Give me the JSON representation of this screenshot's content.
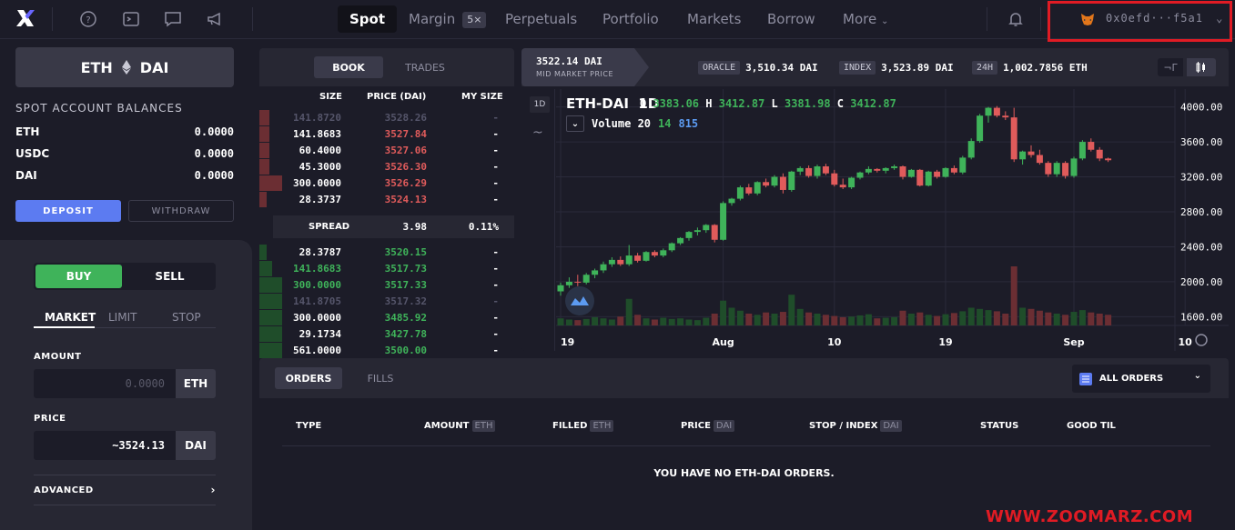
{
  "nav": {
    "tabs": [
      {
        "label": "Spot"
      },
      {
        "label": "Margin",
        "badge": "5×"
      },
      {
        "label": "Perpetuals"
      },
      {
        "label": "Portfolio"
      },
      {
        "label": "Markets"
      },
      {
        "label": "Borrow"
      },
      {
        "label": "More"
      }
    ],
    "wallet": "0x0efd···f5a1"
  },
  "market": {
    "base": "ETH",
    "quote": "DAI"
  },
  "balances": {
    "title": "SPOT ACCOUNT BALANCES",
    "rows": [
      {
        "asset": "ETH",
        "amount": "0.0000"
      },
      {
        "asset": "USDC",
        "amount": "0.0000"
      },
      {
        "asset": "DAI",
        "amount": "0.0000"
      }
    ],
    "deposit": "DEPOSIT",
    "withdraw": "WITHDRAW"
  },
  "order_form": {
    "buy": "BUY",
    "sell": "SELL",
    "types": [
      "MARKET",
      "LIMIT",
      "STOP"
    ],
    "amount_label": "AMOUNT",
    "amount_placeholder": "0.0000",
    "amount_unit": "ETH",
    "price_label": "PRICE",
    "price_value": "~3524.13",
    "price_unit": "DAI",
    "advanced": "ADVANCED"
  },
  "orderbook": {
    "tabs": [
      "BOOK",
      "TRADES"
    ],
    "headers": [
      "SIZE",
      "PRICE (DAI)",
      "MY SIZE"
    ],
    "asks": [
      {
        "size": "141.8720",
        "price": "3528.26",
        "my": "-",
        "depth": 0.04,
        "faded": true
      },
      {
        "size": "141.8683",
        "price": "3527.84",
        "my": "-",
        "depth": 0.04
      },
      {
        "size": "60.4000",
        "price": "3527.06",
        "my": "-",
        "depth": 0.04
      },
      {
        "size": "45.3000",
        "price": "3526.30",
        "my": "-",
        "depth": 0.04
      },
      {
        "size": "300.0000",
        "price": "3526.29",
        "my": "-",
        "depth": 0.09
      },
      {
        "size": "28.3737",
        "price": "3524.13",
        "my": "-",
        "depth": 0.03
      }
    ],
    "spread": {
      "label": "SPREAD",
      "value": "3.98",
      "pct": "0.11%"
    },
    "bids": [
      {
        "size": "28.3787",
        "price": "3520.15",
        "my": "-",
        "depth": 0.03
      },
      {
        "size": "141.8683",
        "price": "3517.73",
        "my": "-",
        "depth": 0.05
      },
      {
        "size": "300.0000",
        "price": "3517.33",
        "my": "-",
        "depth": 0.09
      },
      {
        "size": "141.8705",
        "price": "3517.32",
        "my": "-",
        "depth": 0.09,
        "faded": true
      },
      {
        "size": "300.0000",
        "price": "3485.92",
        "my": "-",
        "depth": 0.09
      },
      {
        "size": "29.1734",
        "price": "3427.78",
        "my": "-",
        "depth": 0.09
      },
      {
        "size": "561.0000",
        "price": "3500.00",
        "my": "-",
        "depth": 0.09
      }
    ]
  },
  "chart_header": {
    "mid_price": "3522.14 DAI",
    "mid_label": "MID MARKET PRICE",
    "oracle_tag": "ORACLE",
    "oracle_value": "3,510.34 DAI",
    "index_tag": "INDEX",
    "index_value": "3,523.89 DAI",
    "vol_tag": "24H",
    "vol_value": "1,002.7856 ETH"
  },
  "chart": {
    "interval_btn": "1D",
    "title": "ETH-DAI",
    "interval": "1D",
    "ohlc": {
      "O": "3383.06",
      "H": "3412.87",
      "L": "3381.98",
      "C": "3412.87"
    },
    "volume_label": "Volume 20",
    "vol_a": "14",
    "vol_b": "815"
  },
  "chart_data": {
    "type": "candlestick",
    "ylim": [
      1500,
      4100
    ],
    "y_ticks": [
      "4000.00",
      "3600.00",
      "3200.00",
      "2800.00",
      "2400.00",
      "2000.00",
      "1600.00"
    ],
    "y_tick_values": [
      4000,
      3600,
      3200,
      2800,
      2400,
      2000,
      1600
    ],
    "x_ticks": [
      "19",
      "Aug",
      "10",
      "19",
      "Sep",
      "10"
    ],
    "x_tick_index": [
      0,
      19,
      32,
      45,
      60,
      73
    ],
    "candles": [
      [
        1890,
        1990,
        1840,
        1960
      ],
      [
        1960,
        2050,
        1930,
        2000
      ],
      [
        2000,
        2080,
        1950,
        1990
      ],
      [
        1990,
        2100,
        1970,
        2080
      ],
      [
        2080,
        2150,
        2040,
        2130
      ],
      [
        2130,
        2230,
        2100,
        2200
      ],
      [
        2200,
        2280,
        2170,
        2250
      ],
      [
        2250,
        2290,
        2180,
        2200
      ],
      [
        2200,
        2420,
        2180,
        2300
      ],
      [
        2300,
        2330,
        2220,
        2240
      ],
      [
        2240,
        2350,
        2230,
        2340
      ],
      [
        2340,
        2360,
        2280,
        2300
      ],
      [
        2300,
        2380,
        2280,
        2360
      ],
      [
        2360,
        2450,
        2340,
        2440
      ],
      [
        2440,
        2510,
        2420,
        2500
      ],
      [
        2500,
        2580,
        2470,
        2570
      ],
      [
        2570,
        2620,
        2530,
        2590
      ],
      [
        2590,
        2660,
        2560,
        2650
      ],
      [
        2650,
        2660,
        2450,
        2480
      ],
      [
        2480,
        2920,
        2470,
        2900
      ],
      [
        2900,
        2960,
        2870,
        2950
      ],
      [
        2950,
        3100,
        2930,
        3080
      ],
      [
        3080,
        3120,
        2990,
        3010
      ],
      [
        3010,
        3150,
        2990,
        3140
      ],
      [
        3140,
        3180,
        3080,
        3100
      ],
      [
        3100,
        3220,
        3080,
        3200
      ],
      [
        3200,
        3240,
        3010,
        3050
      ],
      [
        3050,
        3270,
        3030,
        3260
      ],
      [
        3260,
        3320,
        3220,
        3300
      ],
      [
        3300,
        3330,
        3190,
        3210
      ],
      [
        3210,
        3340,
        3180,
        3320
      ],
      [
        3320,
        3350,
        3220,
        3240
      ],
      [
        3240,
        3280,
        3090,
        3110
      ],
      [
        3110,
        3180,
        3060,
        3080
      ],
      [
        3080,
        3200,
        3060,
        3190
      ],
      [
        3190,
        3260,
        3170,
        3250
      ],
      [
        3250,
        3320,
        3230,
        3290
      ],
      [
        3290,
        3300,
        3250,
        3270
      ],
      [
        3270,
        3310,
        3240,
        3300
      ],
      [
        3300,
        3340,
        3280,
        3320
      ],
      [
        3320,
        3330,
        3170,
        3200
      ],
      [
        3200,
        3290,
        3190,
        3280
      ],
      [
        3280,
        3290,
        3090,
        3100
      ],
      [
        3100,
        3270,
        3090,
        3260
      ],
      [
        3260,
        3280,
        3180,
        3200
      ],
      [
        3200,
        3310,
        3190,
        3300
      ],
      [
        3300,
        3330,
        3230,
        3250
      ],
      [
        3250,
        3440,
        3230,
        3420
      ],
      [
        3420,
        3640,
        3400,
        3610
      ],
      [
        3610,
        3920,
        3590,
        3900
      ],
      [
        3900,
        4000,
        3820,
        3990
      ],
      [
        3990,
        4010,
        3880,
        3900
      ],
      [
        3900,
        3950,
        3850,
        3880
      ],
      [
        3880,
        3990,
        3370,
        3400
      ],
      [
        3400,
        3500,
        3340,
        3490
      ],
      [
        3490,
        3560,
        3420,
        3450
      ],
      [
        3450,
        3510,
        3340,
        3360
      ],
      [
        3360,
        3380,
        3200,
        3230
      ],
      [
        3230,
        3380,
        3200,
        3360
      ],
      [
        3360,
        3380,
        3180,
        3210
      ],
      [
        3210,
        3430,
        3190,
        3410
      ],
      [
        3410,
        3620,
        3390,
        3600
      ],
      [
        3600,
        3640,
        3490,
        3510
      ],
      [
        3510,
        3540,
        3380,
        3410
      ],
      [
        3410,
        3420,
        3370,
        3390
      ]
    ],
    "volumes": [
      0.12,
      0.1,
      0.09,
      0.11,
      0.14,
      0.12,
      0.1,
      0.15,
      0.45,
      0.18,
      0.12,
      0.1,
      0.13,
      0.11,
      0.12,
      0.1,
      0.09,
      0.13,
      0.2,
      0.42,
      0.3,
      0.25,
      0.2,
      0.18,
      0.22,
      0.2,
      0.23,
      0.52,
      0.28,
      0.22,
      0.2,
      0.18,
      0.16,
      0.14,
      0.15,
      0.17,
      0.19,
      0.12,
      0.13,
      0.14,
      0.25,
      0.2,
      0.22,
      0.18,
      0.16,
      0.19,
      0.21,
      0.24,
      0.3,
      0.28,
      0.26,
      0.24,
      0.2,
      1.0,
      0.3,
      0.28,
      0.25,
      0.22,
      0.2,
      0.18,
      0.23,
      0.26,
      0.22,
      0.2,
      0.18
    ]
  },
  "orders": {
    "tabs": [
      "ORDERS",
      "FILLS"
    ],
    "filter": "ALL ORDERS",
    "columns": [
      {
        "label": "TYPE"
      },
      {
        "label": "AMOUNT",
        "unit": "ETH"
      },
      {
        "label": "FILLED",
        "unit": "ETH"
      },
      {
        "label": "PRICE",
        "unit": "DAI"
      },
      {
        "label": "STOP / INDEX",
        "unit": "DAI"
      },
      {
        "label": "STATUS"
      },
      {
        "label": "GOOD TIL"
      }
    ],
    "empty": "YOU HAVE NO ETH-DAI ORDERS."
  },
  "watermark": "WWW.ZOOMARZ.COM",
  "colors": {
    "green": "#3fb35a",
    "red": "#e05b5b",
    "accent": "#5c7bf1",
    "highlight": "#e01b24"
  }
}
